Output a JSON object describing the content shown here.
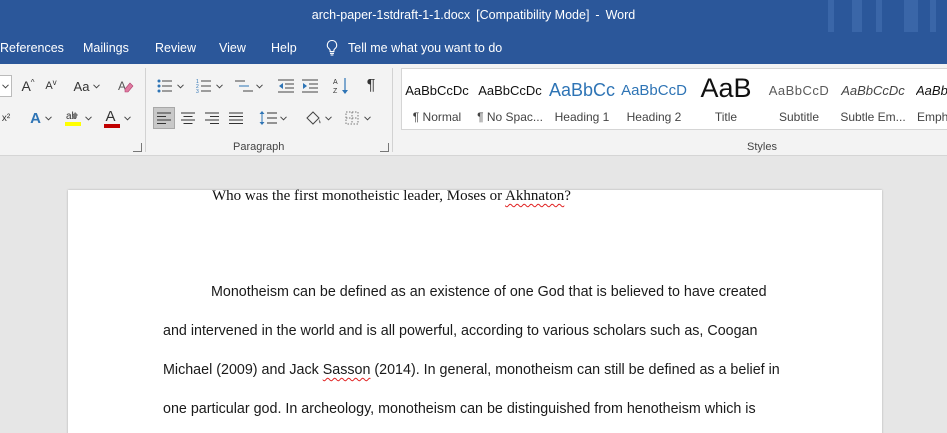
{
  "titlebar": {
    "filename": "arch-paper-1stdraft-1-1.docx",
    "mode": "[Compatibility Mode]",
    "dash": "-",
    "app": "Word"
  },
  "tabs": [
    {
      "label": "References"
    },
    {
      "label": "Mailings"
    },
    {
      "label": "Review"
    },
    {
      "label": "View"
    },
    {
      "label": "Help"
    }
  ],
  "tellme": {
    "label": "Tell me what you want to do",
    "icon": "lightbulb-icon"
  },
  "ribbon": {
    "groups": {
      "paragraph": "Paragraph",
      "styles": "Styles"
    },
    "font_buttons": {
      "aa": "Aa",
      "grow": "A",
      "shrink": "A",
      "color_letter": "A",
      "effects_letter": "A"
    },
    "pilcrow": "¶"
  },
  "styles": [
    {
      "preview": "AaBbCcDc",
      "name": "¶ Normal"
    },
    {
      "preview": "AaBbCcDc",
      "name": "¶ No Spac..."
    },
    {
      "preview": "AaBbCc",
      "name": "Heading 1"
    },
    {
      "preview": "AaBbCcD",
      "name": "Heading 2"
    },
    {
      "preview": "AaB",
      "name": "Title"
    },
    {
      "preview": "AaBbCcD",
      "name": "Subtitle"
    },
    {
      "preview": "AaBbCcDc",
      "name": "Subtle Em..."
    },
    {
      "preview": "AaBb",
      "name": "Empha"
    }
  ],
  "colors": {
    "word_blue": "#2b579a",
    "heading_blue": "#2e74b5",
    "font_color_red": "#c00000",
    "highlight_yellow": "#ffff00"
  },
  "document": {
    "heading": {
      "before": "Who was the first monotheistic leader, Moses or ",
      "misspelled": "Akhnaton",
      "after": "?"
    },
    "lines": [
      {
        "text": "Monotheism can be defined as an existence of one God that is believed to have created"
      },
      {
        "text": "and intervened in the world and is all powerful, according to various scholars such as, Coogan"
      },
      {
        "before": "Michael (2009) and Jack ",
        "misspelled": "Sasson",
        "after": " (2014). In general, monotheism can still be defined as a belief in"
      },
      {
        "text": "one particular god. In archeology, monotheism can be distinguished from henotheism which is"
      }
    ]
  }
}
